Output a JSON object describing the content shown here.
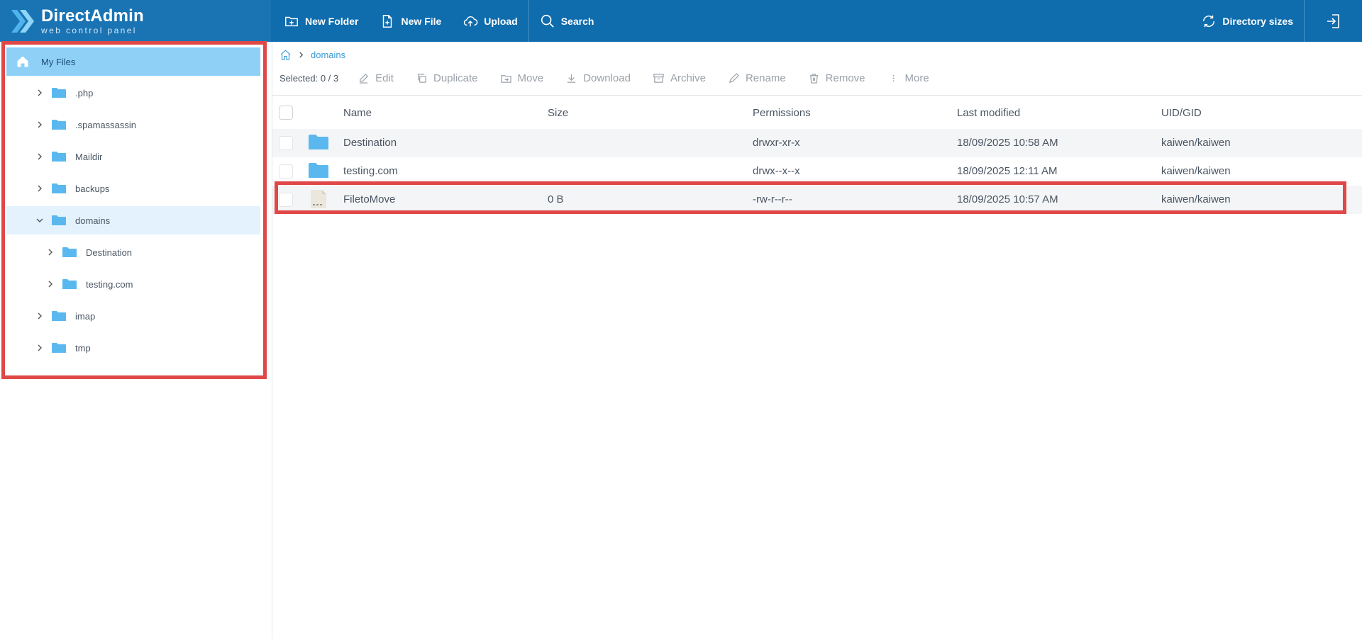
{
  "app": {
    "title": "DirectAdmin",
    "subtitle": "web control panel"
  },
  "toolbar": {
    "new_folder": "New Folder",
    "new_file": "New File",
    "upload": "Upload",
    "search": "Search",
    "directory_sizes": "Directory sizes"
  },
  "sidebar": {
    "home": "My Files",
    "items": [
      {
        "label": ".php"
      },
      {
        "label": ".spamassassin"
      },
      {
        "label": "Maildir"
      },
      {
        "label": "backups"
      },
      {
        "label": "domains"
      },
      {
        "label": "Destination"
      },
      {
        "label": "testing.com"
      },
      {
        "label": "imap"
      },
      {
        "label": "tmp"
      }
    ]
  },
  "breadcrumb": {
    "current": "domains"
  },
  "actions": {
    "selected": "Selected: 0 / 3",
    "edit": "Edit",
    "duplicate": "Duplicate",
    "move": "Move",
    "download": "Download",
    "archive": "Archive",
    "rename": "Rename",
    "remove": "Remove",
    "more": "More"
  },
  "table": {
    "headers": {
      "name": "Name",
      "size": "Size",
      "permissions": "Permissions",
      "modified": "Last modified",
      "uid": "UID/GID"
    },
    "rows": [
      {
        "name": "Destination",
        "size": "",
        "permissions": "drwxr-xr-x",
        "modified": "18/09/2025 10:58 AM",
        "uid": "kaiwen/kaiwen"
      },
      {
        "name": "testing.com",
        "size": "",
        "permissions": "drwx--x--x",
        "modified": "18/09/2025 12:11 AM",
        "uid": "kaiwen/kaiwen"
      },
      {
        "name": "FiletoMove",
        "size": "0 B",
        "permissions": "-rw-r--r--",
        "modified": "18/09/2025 10:57 AM",
        "uid": "kaiwen/kaiwen"
      }
    ]
  },
  "colors": {
    "topbar": "#0f6cad",
    "accent": "#3b9bd6",
    "folder": "#5bb8ee",
    "highlight_box": "#e04848"
  }
}
